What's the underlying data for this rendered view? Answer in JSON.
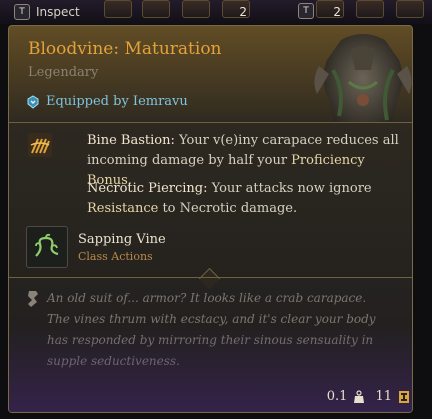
{
  "topbar": {
    "inspect_key": "T",
    "inspect_label": "Inspect",
    "slot_counts": [
      "2",
      "2"
    ],
    "t_key": "T"
  },
  "item": {
    "name": "Bloodvine: Maturation",
    "rarity": "Legendary",
    "equipped": "Equipped by Iemravu",
    "abilities": [
      {
        "name": "Bine Bastion:",
        "text_before": " Your v(e)iny carapace reduces all incoming damage by half your ",
        "highlight": "Proficiency Bonus",
        "text_after": "."
      },
      {
        "name": "Necrotic Piercing:",
        "text_before": " Your attacks now ignore ",
        "highlight": "Resistance",
        "text_after": " to Necrotic damage."
      }
    ],
    "action": {
      "name": "Sapping Vine",
      "type": "Class Actions"
    },
    "lore": "An old suit of... armor? It looks like a crab carapace. The vines thrum with ecstacy, and it's clear your body has responded by mirroring their sinous sensuality in supple seductiveness.",
    "weight": "0.1",
    "value": "11"
  },
  "colors": {
    "title": "#e3a23a",
    "equipped": "#7fc4e0",
    "action_type": "#b7894a",
    "lore": "#7b766e"
  },
  "icons": [
    "armor-image",
    "equipped-icon",
    "passive-icon",
    "vine-action-icon",
    "lore-icon",
    "weight-icon",
    "gold-icon"
  ]
}
